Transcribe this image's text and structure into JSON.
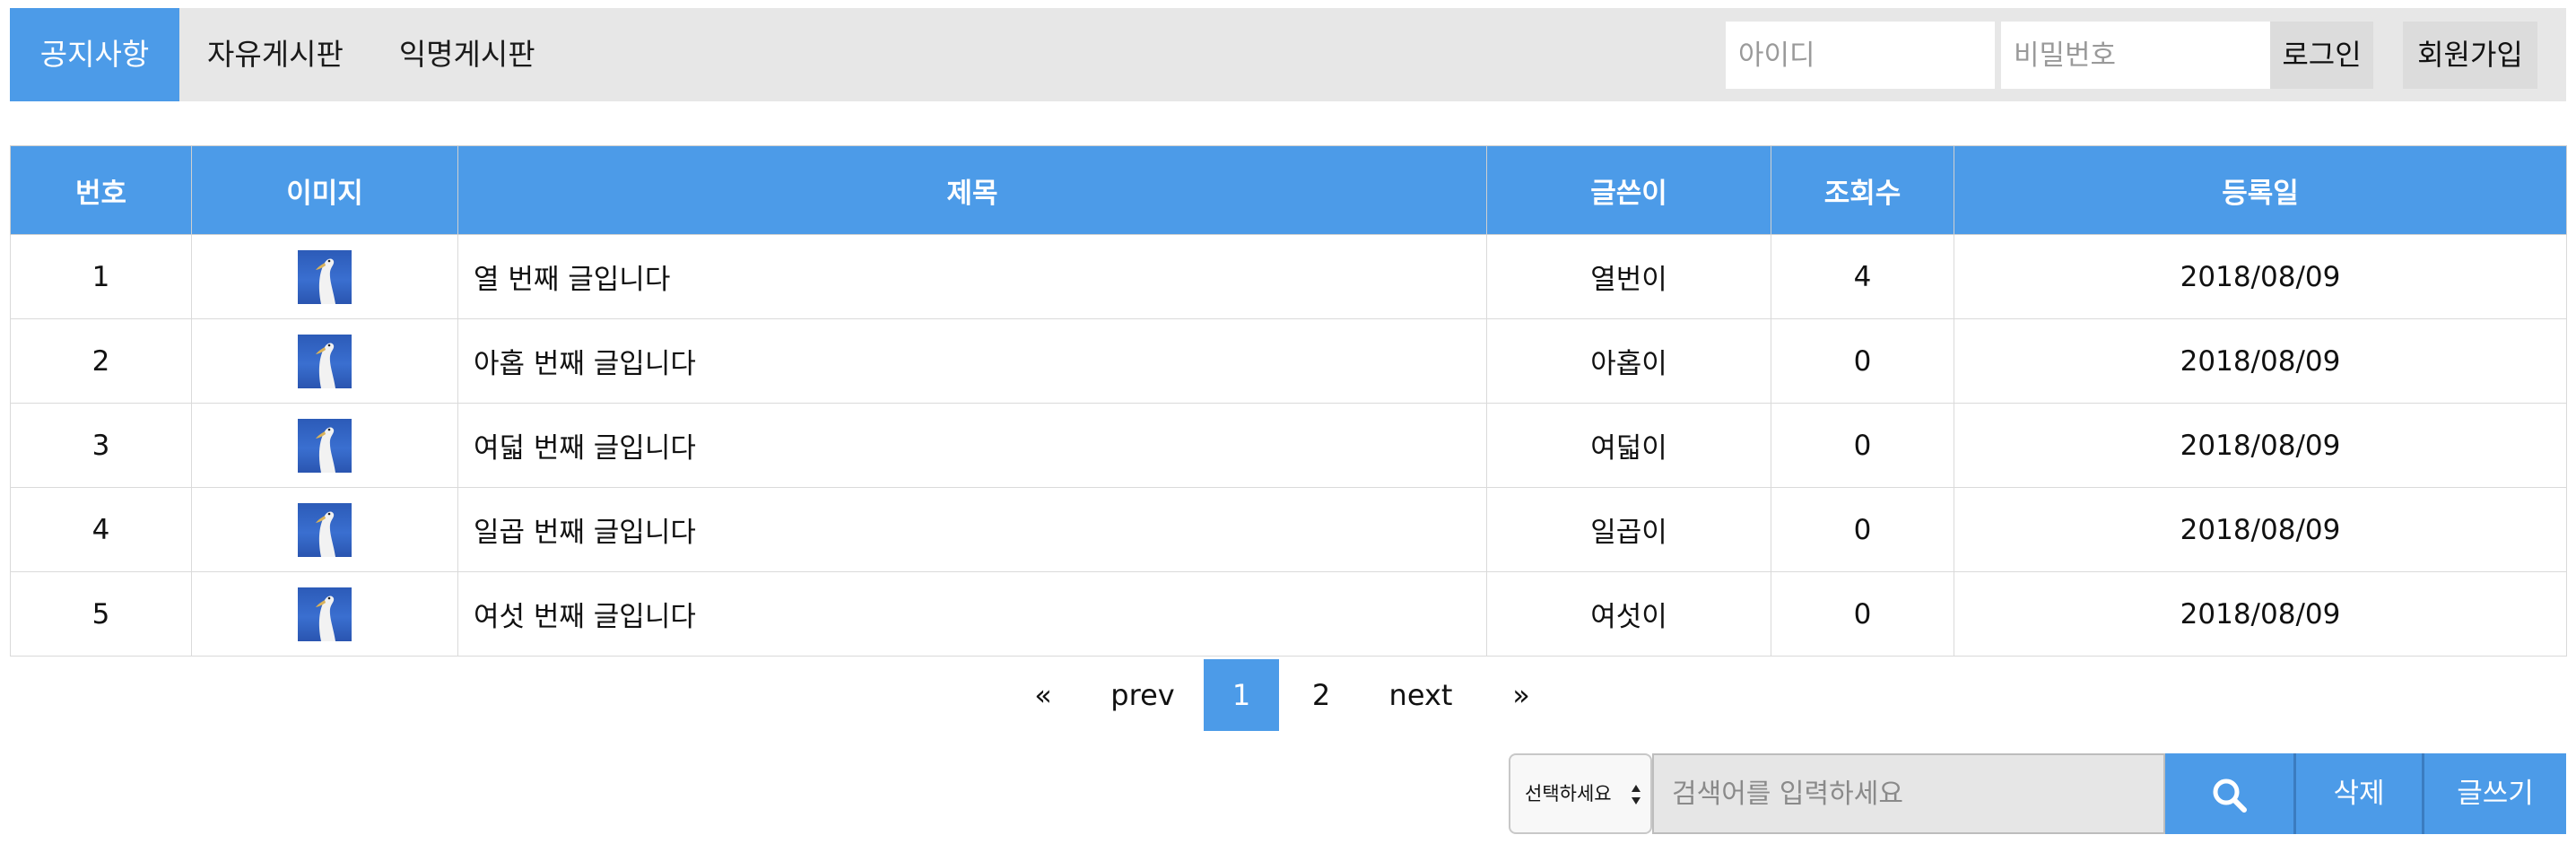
{
  "nav": {
    "items": [
      {
        "label": "공지사항",
        "active": true
      },
      {
        "label": "자유게시판",
        "active": false
      },
      {
        "label": "익명게시판",
        "active": false
      }
    ],
    "id_placeholder": "아이디",
    "pw_placeholder": "비밀번호",
    "login_label": "로그인",
    "join_label": "회원가입"
  },
  "table": {
    "headers": [
      "번호",
      "이미지",
      "제목",
      "글쓴이",
      "조회수",
      "등록일"
    ],
    "rows": [
      {
        "no": "1",
        "title": "열 번째 글입니다",
        "author": "열번이",
        "views": "4",
        "date": "2018/08/09"
      },
      {
        "no": "2",
        "title": "아홉 번째 글입니다",
        "author": "아홉이",
        "views": "0",
        "date": "2018/08/09"
      },
      {
        "no": "3",
        "title": "여덟 번째 글입니다",
        "author": "여덟이",
        "views": "0",
        "date": "2018/08/09"
      },
      {
        "no": "4",
        "title": "일곱 번째 글입니다",
        "author": "일곱이",
        "views": "0",
        "date": "2018/08/09"
      },
      {
        "no": "5",
        "title": "여섯 번째 글입니다",
        "author": "여섯이",
        "views": "0",
        "date": "2018/08/09"
      }
    ]
  },
  "pagination": {
    "first": "«",
    "prev": "prev",
    "current": "1",
    "page2": "2",
    "next": "next",
    "last": "»"
  },
  "search": {
    "select_value": "선택하세요",
    "placeholder": "검색어를 입력하세요",
    "search_icon": "search-icon",
    "delete_label": "삭제",
    "write_label": "글쓰기"
  },
  "colors": {
    "accent": "#4c9be8",
    "nav_bg": "#e7e7e7"
  }
}
